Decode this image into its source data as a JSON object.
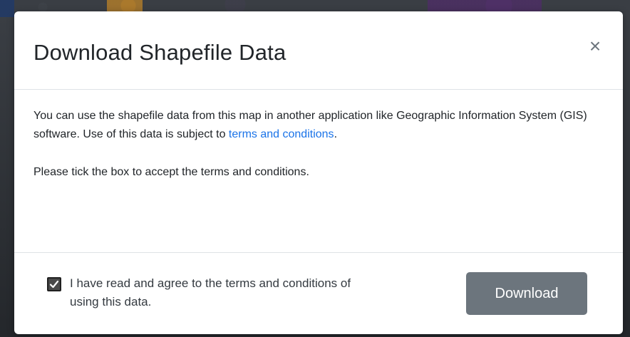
{
  "modal": {
    "title": "Download Shapefile Data",
    "close_label": "×",
    "body": {
      "intro_text": "You can use the shapefile data from this map in another application like Geographic Information System (GIS) software. Use of this data is subject to",
      "terms_link": "terms and conditions",
      "intro_end": ".",
      "accept_instruction": "Please tick the box to accept the terms and conditions."
    },
    "footer": {
      "agree_label": "I have read and agree to the terms and conditions of using this data.",
      "agree_checked": true,
      "download_label": "Download"
    }
  },
  "colors": {
    "link": "#1a73e8",
    "button_bg": "#6c757d"
  },
  "icons": {
    "close": "close-icon",
    "check": "checkmark-icon"
  }
}
